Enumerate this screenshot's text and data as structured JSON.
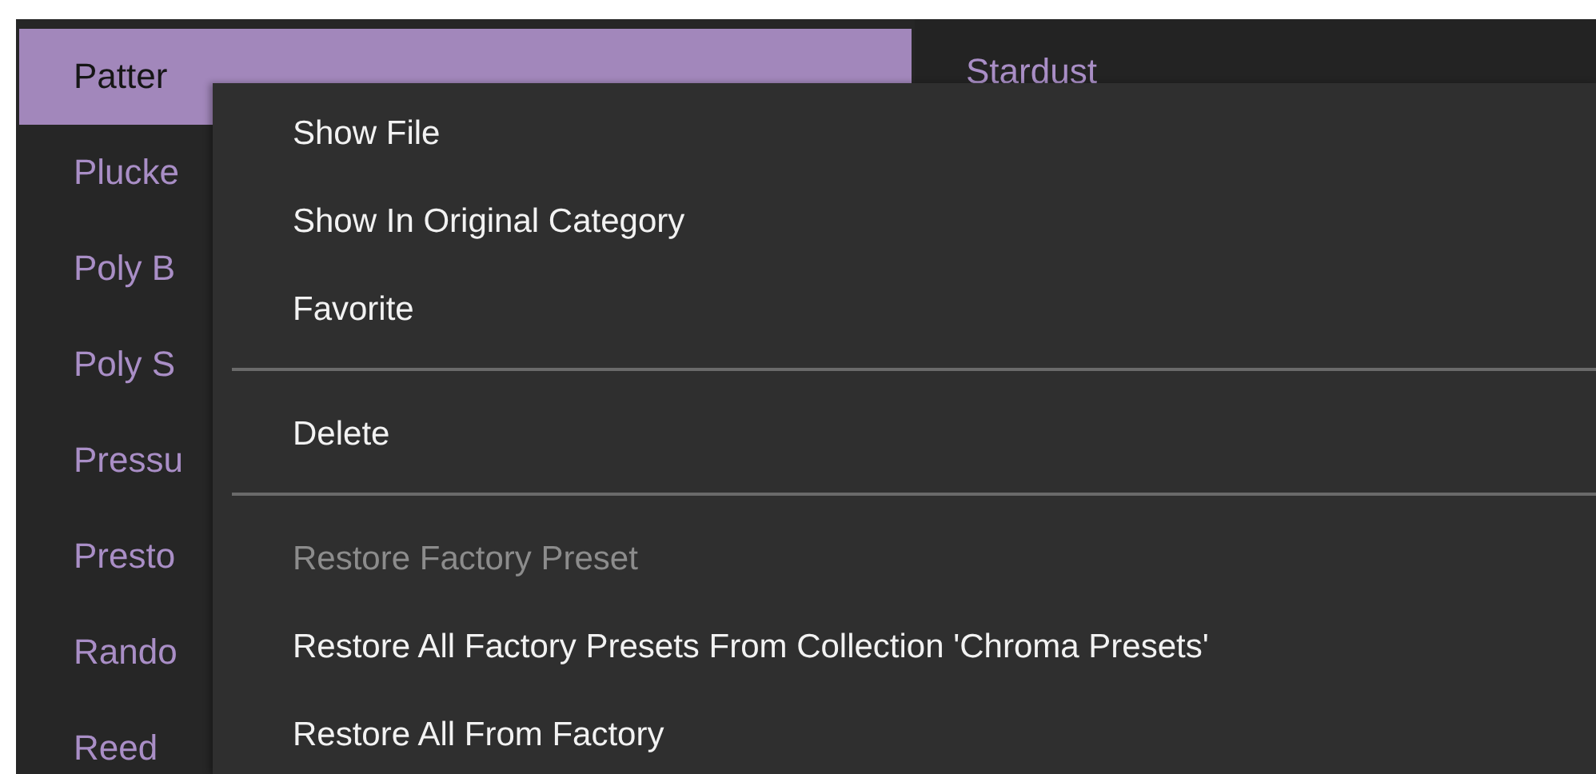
{
  "preset_list": {
    "items": [
      {
        "label": "Patter",
        "selected": true
      },
      {
        "label": "Plucke",
        "selected": false
      },
      {
        "label": "Poly B",
        "selected": false
      },
      {
        "label": "Poly S",
        "selected": false
      },
      {
        "label": "Pressu",
        "selected": false
      },
      {
        "label": "Presto",
        "selected": false
      },
      {
        "label": "Rando",
        "selected": false
      },
      {
        "label": "Reed",
        "selected": false
      }
    ]
  },
  "preset_list_2": {
    "items": [
      {
        "label": "Stardust",
        "selected": false
      }
    ]
  },
  "context_menu": {
    "items": [
      {
        "kind": "item",
        "label": "Show File",
        "disabled": false
      },
      {
        "kind": "item",
        "label": "Show In Original Category",
        "disabled": false
      },
      {
        "kind": "item",
        "label": "Favorite",
        "disabled": false
      },
      {
        "kind": "separator"
      },
      {
        "kind": "item",
        "label": "Delete",
        "disabled": false
      },
      {
        "kind": "separator"
      },
      {
        "kind": "item",
        "label": "Restore Factory Preset",
        "disabled": true
      },
      {
        "kind": "item",
        "label": "Restore All Factory Presets From Collection 'Chroma Presets'",
        "disabled": false
      },
      {
        "kind": "item",
        "label": "Restore All From Factory",
        "disabled": false
      }
    ]
  }
}
